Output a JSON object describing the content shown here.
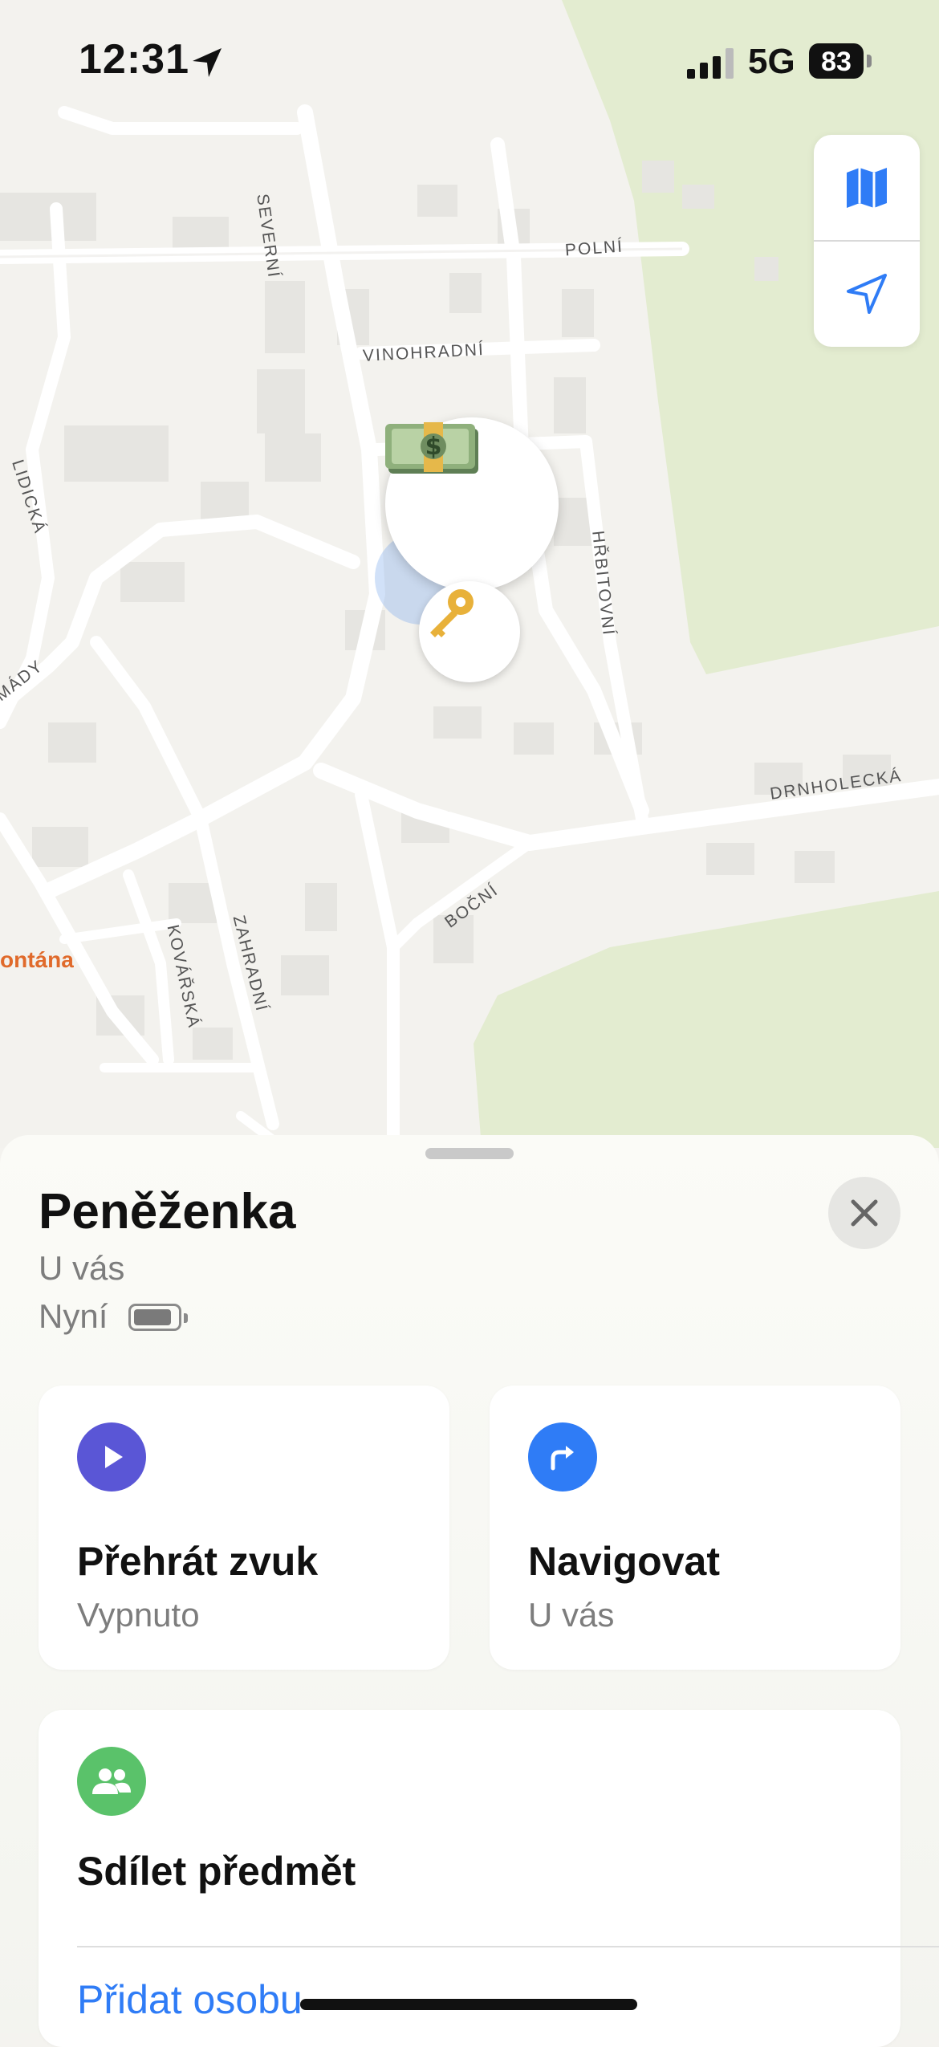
{
  "status_bar": {
    "time": "12:31",
    "network": "5G",
    "battery": "83"
  },
  "map": {
    "streets": {
      "severni": "SEVERNÍ",
      "polni": "POLNÍ",
      "vinohradni": "VINOHRADNÍ",
      "lidicka": "LIDICKÁ",
      "hrbitovni": "HŘBITOVNÍ",
      "mady": "MÁDY",
      "drnholecka": "DRNHOLECKÁ",
      "bocni": "BOČNÍ",
      "kovarska": "KOVÁŘSKÁ",
      "zahradni": "ZAHRADNÍ"
    },
    "poi": "ontána",
    "pins": {
      "item": "money-emoji",
      "owner": "key-emoji"
    }
  },
  "item": {
    "name": "Peněženka",
    "location": "U vás",
    "updated": "Nyní"
  },
  "actions": {
    "play_sound": {
      "label": "Přehrát zvuk",
      "value": "Vypnuto",
      "color": "#5a56d6"
    },
    "navigate": {
      "label": "Navigovat",
      "value": "U vás",
      "color": "#2f7cf6"
    }
  },
  "share": {
    "label": "Sdílet předmět",
    "add_person": "Přidat osobu",
    "color": "#5ac26a"
  }
}
